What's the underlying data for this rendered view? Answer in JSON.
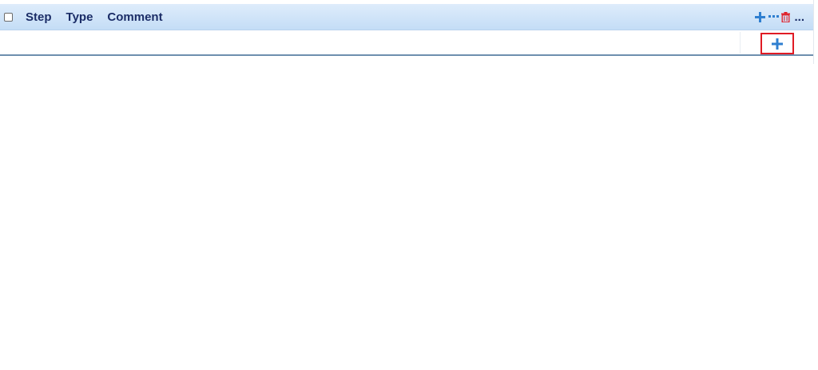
{
  "grid": {
    "header": {
      "columns": [
        "Step",
        "Type",
        "Comment"
      ]
    },
    "toolbar": {
      "more_label": "..."
    }
  },
  "colors": {
    "header_text": "#1b2d67",
    "icon_blue": "#2f7fd0",
    "icon_red": "#e01b24",
    "highlight_border": "#e01b24"
  },
  "icons": {
    "toolbar": [
      "plus-icon",
      "dots-icon",
      "trash-icon"
    ],
    "row": [
      "plus-icon"
    ]
  }
}
